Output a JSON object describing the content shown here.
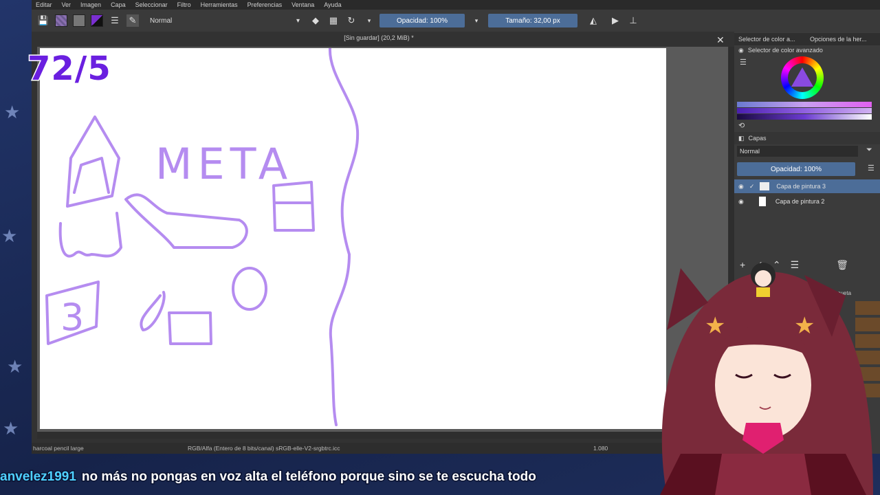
{
  "menu": [
    "Editar",
    "Ver",
    "Imagen",
    "Capa",
    "Seleccionar",
    "Filtro",
    "Herramientas",
    "Preferencias",
    "Ventana",
    "Ayuda"
  ],
  "toolbar": {
    "blend_mode": "Normal",
    "opacity": "Opacidad: 100%",
    "size": "Tamaño: 32,00 px"
  },
  "document": {
    "title": "[Sin guardar] (20,2 MiB) *"
  },
  "dock": {
    "tabs": [
      "Selector de color a...",
      "Opciones de la her..."
    ],
    "color_selector_title": "Selector de color avanzado",
    "layers_title": "Capas",
    "layers_blend": "Normal",
    "layers_opacity": "Opacidad: 100%",
    "layers": [
      {
        "name": "Capa de pintura 3"
      },
      {
        "name": "Capa de pintura 2"
      }
    ],
    "presets_partial": "efini",
    "presets_tag": "queta"
  },
  "status": {
    "brush": "harcoal pencil large",
    "colorspace": "RGB/Alfa (Entero de 8 bits/canal)  sRGB-elle-V2-srgbtrc.icc",
    "dims": "1.080"
  },
  "overlay": {
    "counter": "72/5"
  },
  "chat": {
    "user": "anvelez1991",
    "message": "no más no pongas en voz alta el teléfono porque sino se te escucha todo"
  },
  "canvas_text": {
    "meta": "META",
    "number": "3"
  },
  "colors": {
    "stroke": "#b58cf0",
    "accent": "#4c6d98",
    "chat_user": "#4fd0ff"
  }
}
